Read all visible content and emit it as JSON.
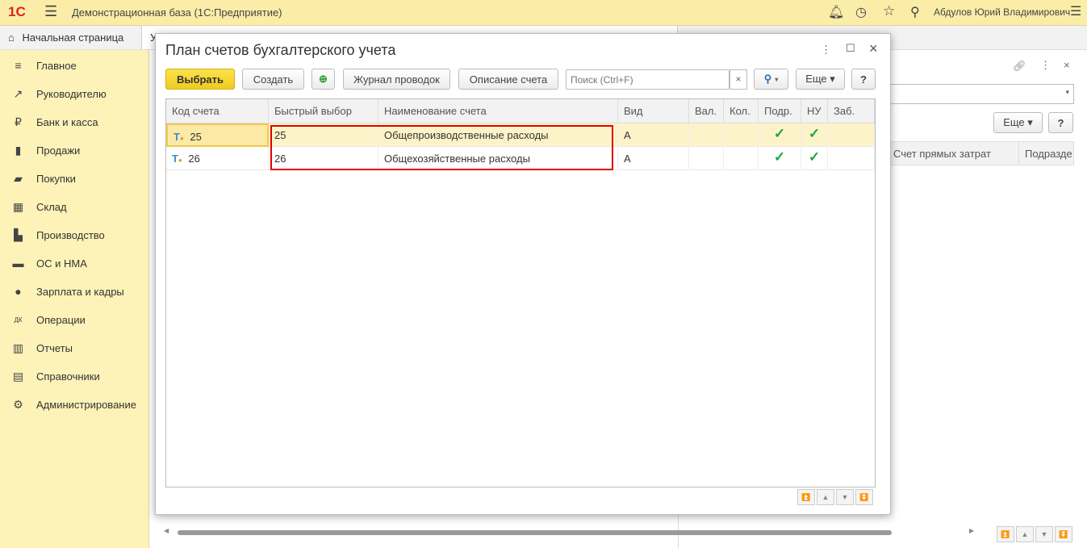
{
  "app": {
    "logo": "1С",
    "title": "Демонстрационная база  (1С:Предприятие)",
    "user": "Абдулов Юрий Владимирович"
  },
  "tabs": [
    {
      "label": "Начальная страница"
    },
    {
      "label": "У"
    }
  ],
  "sidebar": {
    "items": [
      {
        "label": "Главное",
        "icon": "≡"
      },
      {
        "label": "Руководителю",
        "icon": "↗"
      },
      {
        "label": "Банк и касса",
        "icon": "₽"
      },
      {
        "label": "Продажи",
        "icon": "▮"
      },
      {
        "label": "Покупки",
        "icon": "▰"
      },
      {
        "label": "Склад",
        "icon": "▦"
      },
      {
        "label": "Производство",
        "icon": "▙"
      },
      {
        "label": "ОС и НМА",
        "icon": "▬"
      },
      {
        "label": "Зарплата и кадры",
        "icon": "●"
      },
      {
        "label": "Операции",
        "icon": "ДК"
      },
      {
        "label": "Отчеты",
        "icon": "▥"
      },
      {
        "label": "Справочники",
        "icon": "▤"
      },
      {
        "label": "Администрирование",
        "icon": "⚙"
      }
    ]
  },
  "dialog": {
    "title": "План счетов бухгалтерского учета",
    "toolbar": {
      "select": "Выбрать",
      "create": "Создать",
      "journal": "Журнал проводок",
      "description": "Описание счета",
      "search_placeholder": "Поиск (Ctrl+F)",
      "clear": "×",
      "more": "Еще ▾",
      "help": "?"
    },
    "columns": [
      "Код счета",
      "Быстрый выбор",
      "Наименование счета",
      "Вид",
      "Вал.",
      "Кол.",
      "Подр.",
      "НУ",
      "Заб."
    ],
    "rows": [
      {
        "code": "25",
        "quick": "25",
        "name": "Общепроизводственные расходы",
        "kind": "А",
        "val": "",
        "qty": "",
        "dept": "✓",
        "nu": "✓",
        "off": ""
      },
      {
        "code": "26",
        "quick": "26",
        "name": "Общехозяйственные расходы",
        "kind": "А",
        "val": "",
        "qty": "",
        "dept": "✓",
        "nu": "✓",
        "off": ""
      }
    ]
  },
  "background": {
    "more": "Еще ▾",
    "help": "?",
    "col1": "Счет прямых затрат",
    "col2": "Подразде"
  },
  "colors": {
    "accent": "#f5d33a",
    "highlight": "#e00000",
    "selected_row": "#fdf3c9"
  }
}
